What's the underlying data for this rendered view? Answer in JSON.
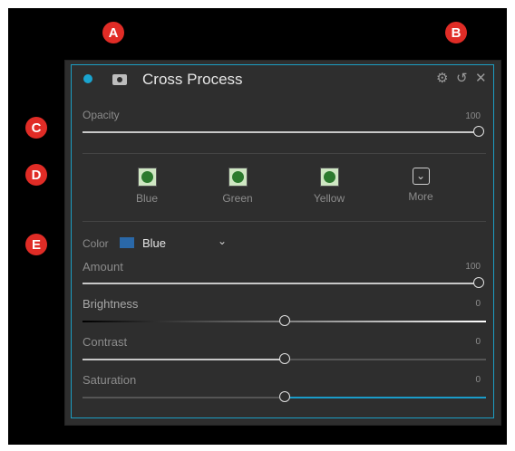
{
  "markers": [
    "A",
    "B",
    "C",
    "D",
    "E"
  ],
  "header": {
    "title": "Cross Process",
    "settings_icon": "gear-icon",
    "reset_icon": "reset-icon",
    "close_icon": "close-icon"
  },
  "opacity": {
    "label": "Opacity",
    "value": "100",
    "level": 1.0
  },
  "presets": [
    {
      "label": "Blue",
      "icon": "tree-thumbnail-icon"
    },
    {
      "label": "Green",
      "icon": "tree-thumbnail-icon"
    },
    {
      "label": "Yellow",
      "icon": "tree-thumbnail-icon"
    },
    {
      "label": "More",
      "icon": "chevron-down-box-icon"
    }
  ],
  "color": {
    "label": "Color",
    "value": "Blue",
    "swatch": "#2a68a8"
  },
  "sliders": [
    {
      "label": "Amount",
      "value": "100",
      "level": 1.0
    },
    {
      "label": "Brightness",
      "value": "0",
      "level": 0.5
    },
    {
      "label": "Contrast",
      "value": "0",
      "level": 0.5
    },
    {
      "label": "Saturation",
      "value": "0",
      "level": 0.5
    }
  ],
  "accent_color": "#1aa4cf"
}
